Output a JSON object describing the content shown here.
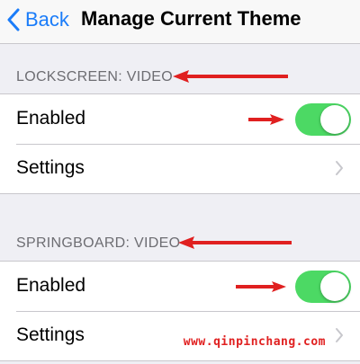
{
  "nav": {
    "back_label": "Back",
    "title": "Manage Current Theme"
  },
  "lockscreen": {
    "header": "LOCKSCREEN: VIDEO",
    "enabled_label": "Enabled",
    "enabled_state": true,
    "settings_label": "Settings"
  },
  "springboard": {
    "header": "SPRINGBOARD: VIDEO",
    "enabled_label": "Enabled",
    "enabled_state": true,
    "settings_label": "Settings"
  },
  "watermark": "www.qinpinchang.com",
  "colors": {
    "accent": "#1a7cf9",
    "toggle_on": "#4cd964",
    "annotation": "#e02020"
  }
}
